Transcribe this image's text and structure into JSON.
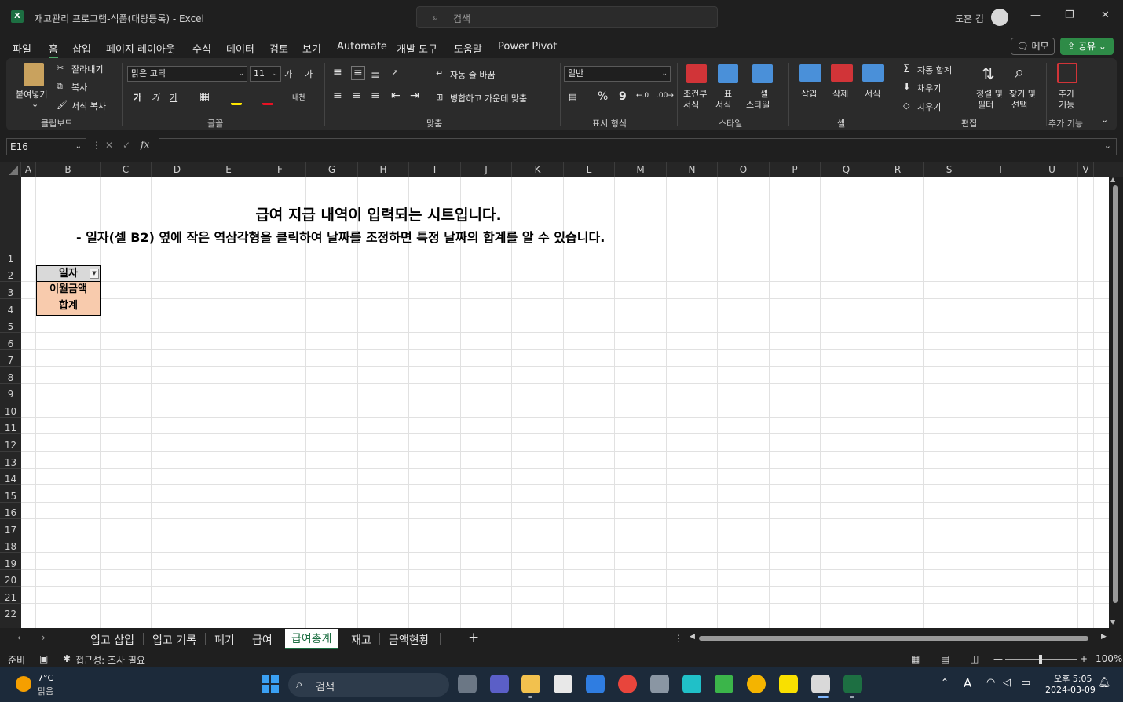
{
  "window": {
    "title": "재고관리 프로그램-식품(대량등록) - Excel",
    "search_placeholder": "검색",
    "user_name": "도훈 김"
  },
  "menu": {
    "items": [
      "파일",
      "홈",
      "삽입",
      "페이지 레이아웃",
      "수식",
      "데이터",
      "검토",
      "보기",
      "Automate",
      "개발 도구",
      "도움말",
      "Power Pivot"
    ],
    "active": "홈",
    "memo_label": "메모",
    "share_label": "공유"
  },
  "ribbon": {
    "clipboard": {
      "paste": "붙여넣기",
      "cut": "잘라내기",
      "copy": "복사",
      "format_painter": "서식 복사",
      "group": "클립보드"
    },
    "font": {
      "name": "맑은 고딕",
      "size": "11",
      "group": "글꼴",
      "grow": "가",
      "shrink": "가",
      "bold": "가",
      "italic": "가",
      "underline": "가"
    },
    "alignment": {
      "wrap": "자동 줄 바꿈",
      "merge": "병합하고 가운데 맞춤",
      "group": "맞춤"
    },
    "number": {
      "format": "일반",
      "percent": "%",
      "comma": "9",
      "group": "표시 형식"
    },
    "styles": {
      "conditional": "조건부\n서식",
      "conditional_l1": "조건부",
      "conditional_l2": "서식",
      "table_l1": "표",
      "table_l2": "서식",
      "cell_l1": "셀",
      "cell_l2": "스타일",
      "group": "스타일"
    },
    "cells": {
      "insert": "삽입",
      "delete": "삭제",
      "format": "서식",
      "group": "셀"
    },
    "editing": {
      "autosum": "자동 합계",
      "fill": "채우기",
      "clear": "지우기",
      "sort_l1": "정렬 및",
      "sort_l2": "필터",
      "find_l1": "찾기 및",
      "find_l2": "선택",
      "group": "편집"
    },
    "addins": {
      "l1": "추가",
      "l2": "기능",
      "group": "추가 기능"
    }
  },
  "formula_bar": {
    "name_box": "E16",
    "fx": "fx",
    "value": ""
  },
  "grid": {
    "columns": [
      "A",
      "B",
      "C",
      "D",
      "E",
      "F",
      "G",
      "H",
      "I",
      "J",
      "K",
      "L",
      "M",
      "N",
      "O",
      "P",
      "Q",
      "R",
      "S",
      "T",
      "U",
      "V"
    ],
    "rows": [
      "1",
      "2",
      "3",
      "4",
      "5",
      "6",
      "7",
      "8",
      "9",
      "10",
      "11",
      "12",
      "13",
      "14",
      "15",
      "16",
      "17",
      "18",
      "19",
      "20",
      "21",
      "22"
    ],
    "heading_title": "급여 지급 내역이 입력되는 시트입니다.",
    "heading_subtitle": "- 일자(셀 B2) 옆에 작은 역삼각형을 클릭하여 날짜를 조정하면 특정 날짜의 합계를 알 수 있습니다.",
    "cells": {
      "b2": "일자",
      "b3": "이월금액",
      "b4": "합계"
    },
    "colors": {
      "b2_fill": "#d9d9d9",
      "b3_fill": "#f8cbad",
      "b4_fill": "#f8cbad"
    }
  },
  "sheet_tabs": {
    "tabs": [
      "입고 삽입",
      "입고 기록",
      "폐기",
      "급여",
      "급여총계",
      "재고",
      "금액현황"
    ],
    "active": "급여총계",
    "add": "+"
  },
  "status_bar": {
    "mode": "준비",
    "accessibility": "접근성: 조사 필요",
    "zoom": "100%"
  },
  "taskbar": {
    "weather_temp": "7°C",
    "weather_desc": "맑음",
    "search": "검색",
    "time": "오후 5:05",
    "date": "2024-03-09",
    "ime": "A"
  }
}
